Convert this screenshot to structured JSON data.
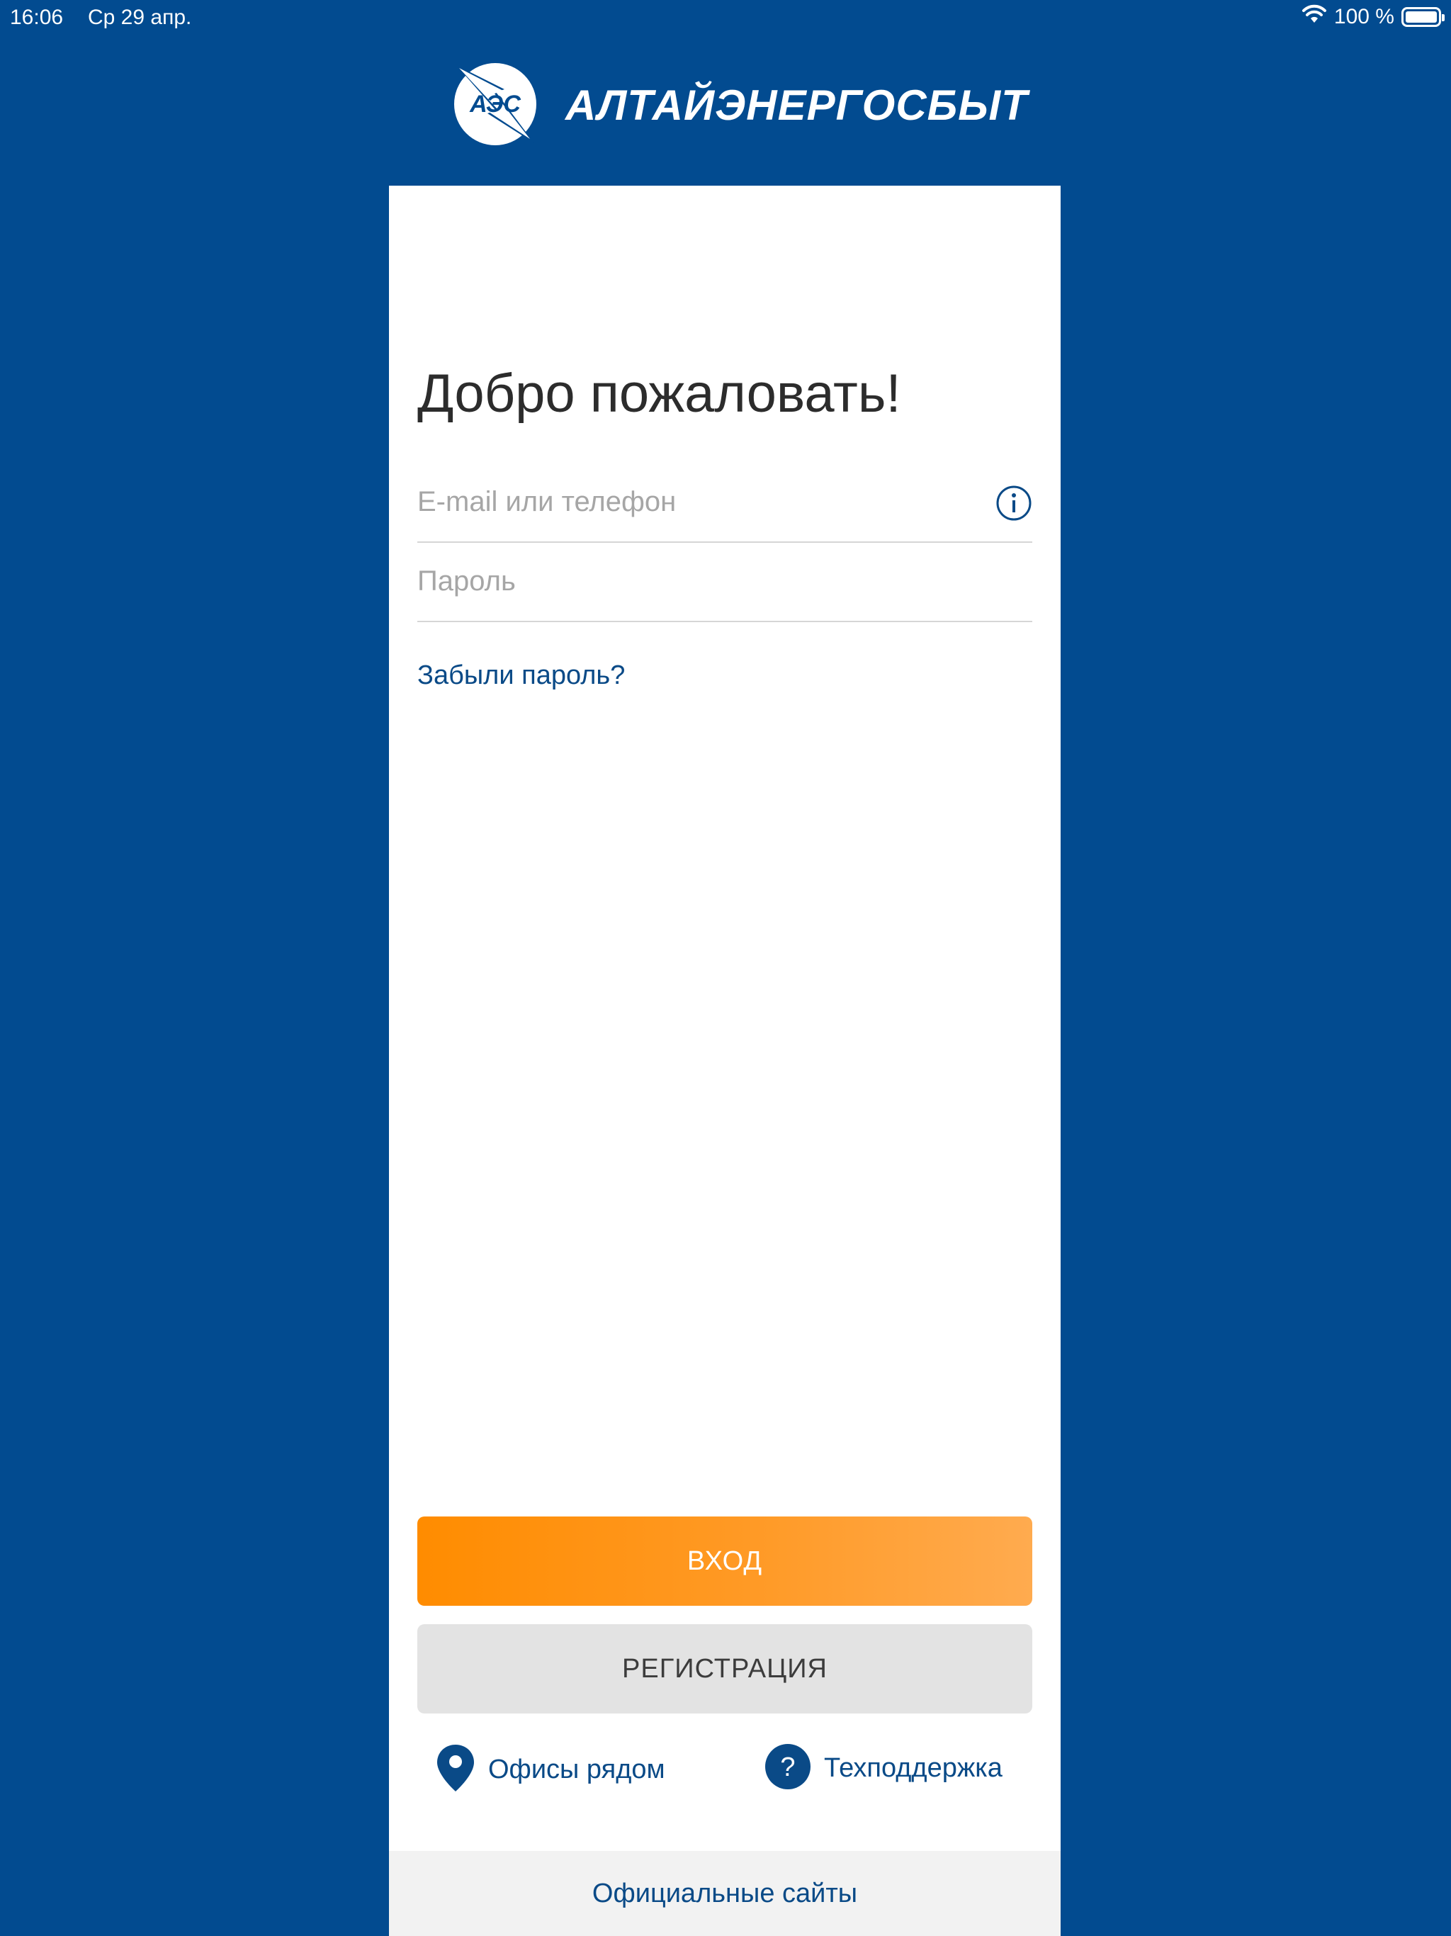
{
  "status_bar": {
    "time": "16:06",
    "date": "Ср 29 апр.",
    "battery_label": "100 %",
    "battery_level": 1.0,
    "wifi_icon": "wifi-icon",
    "battery_icon": "battery-icon"
  },
  "header": {
    "logo_text": "АЭС",
    "brand_name": "АЛТАЙЭНЕРГОСБЫТ"
  },
  "login": {
    "welcome": "Добро пожаловать!",
    "email_placeholder": "E-mail или телефон",
    "email_value": "",
    "password_placeholder": "Пароль",
    "password_value": "",
    "info_icon": "info-icon",
    "forgot_password": "Забыли пароль?",
    "login_button": "ВХОД",
    "register_button": "РЕГИСТРАЦИЯ",
    "offices_link": "Офисы рядом",
    "offices_icon": "location-pin-icon",
    "support_link": "Техподдержка",
    "support_icon": "question-circle-icon",
    "official_sites": "Официальные сайты"
  },
  "colors": {
    "primary_blue": "#024b90",
    "accent_orange": "#ff8c00",
    "link_blue": "#0a4a87",
    "register_gray": "#e3e3e3",
    "footer_gray": "#f2f2f2"
  }
}
